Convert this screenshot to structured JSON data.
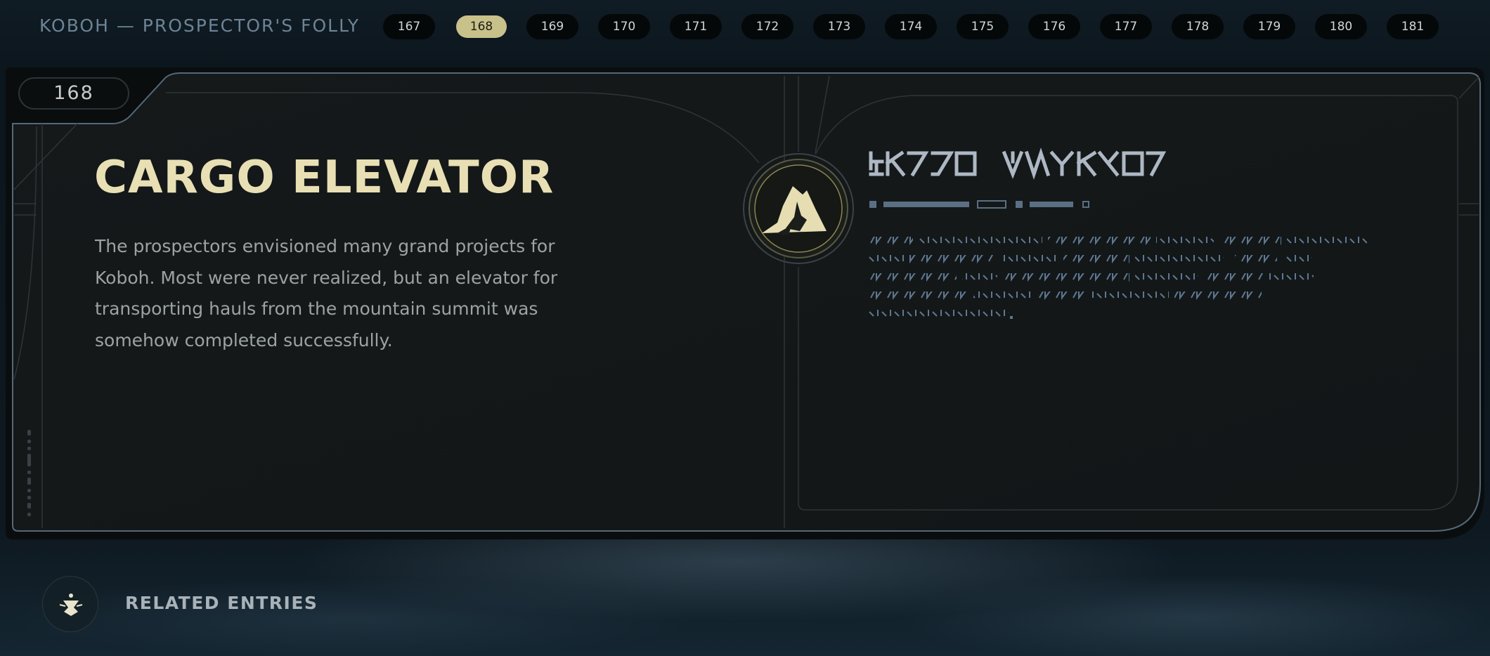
{
  "header": {
    "region_title": "KOBOH — PROSPECTOR'S FOLLY",
    "pages": [
      "167",
      "168",
      "169",
      "170",
      "171",
      "172",
      "173",
      "174",
      "175",
      "176",
      "177",
      "178",
      "179",
      "180",
      "181"
    ],
    "active_page": "168"
  },
  "entry": {
    "number": "168",
    "title": "CARGO ELEVATOR",
    "description": "The prospectors envisioned many grand projects for Koboh. Most were never realized, but an elevator for transporting hauls from the mountain summit was somehow completed successfully.",
    "emblem_icon": "mountain-emblem-icon"
  },
  "footer": {
    "related_label": "RELATED ENTRIES",
    "related_icon": "meditation-figure-icon"
  },
  "colors": {
    "accent": "#c9c18a",
    "title": "#e8e0b4",
    "alien_text": "#6f8aa6",
    "border": "#4a5a66"
  }
}
